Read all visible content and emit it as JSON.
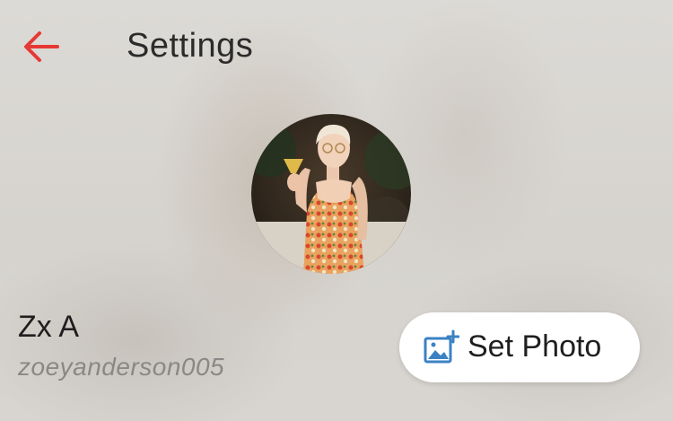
{
  "header": {
    "back_icon": "arrow-left-icon",
    "title": "Settings"
  },
  "profile": {
    "avatar_icon": "profile-photo",
    "display_name": "Zx A",
    "username": "zoeyanderson005"
  },
  "actions": {
    "set_photo_label": "Set Photo",
    "set_photo_icon": "add-photo-icon"
  },
  "colors": {
    "accent": "#e53935",
    "photo_icon": "#3b82c4"
  }
}
